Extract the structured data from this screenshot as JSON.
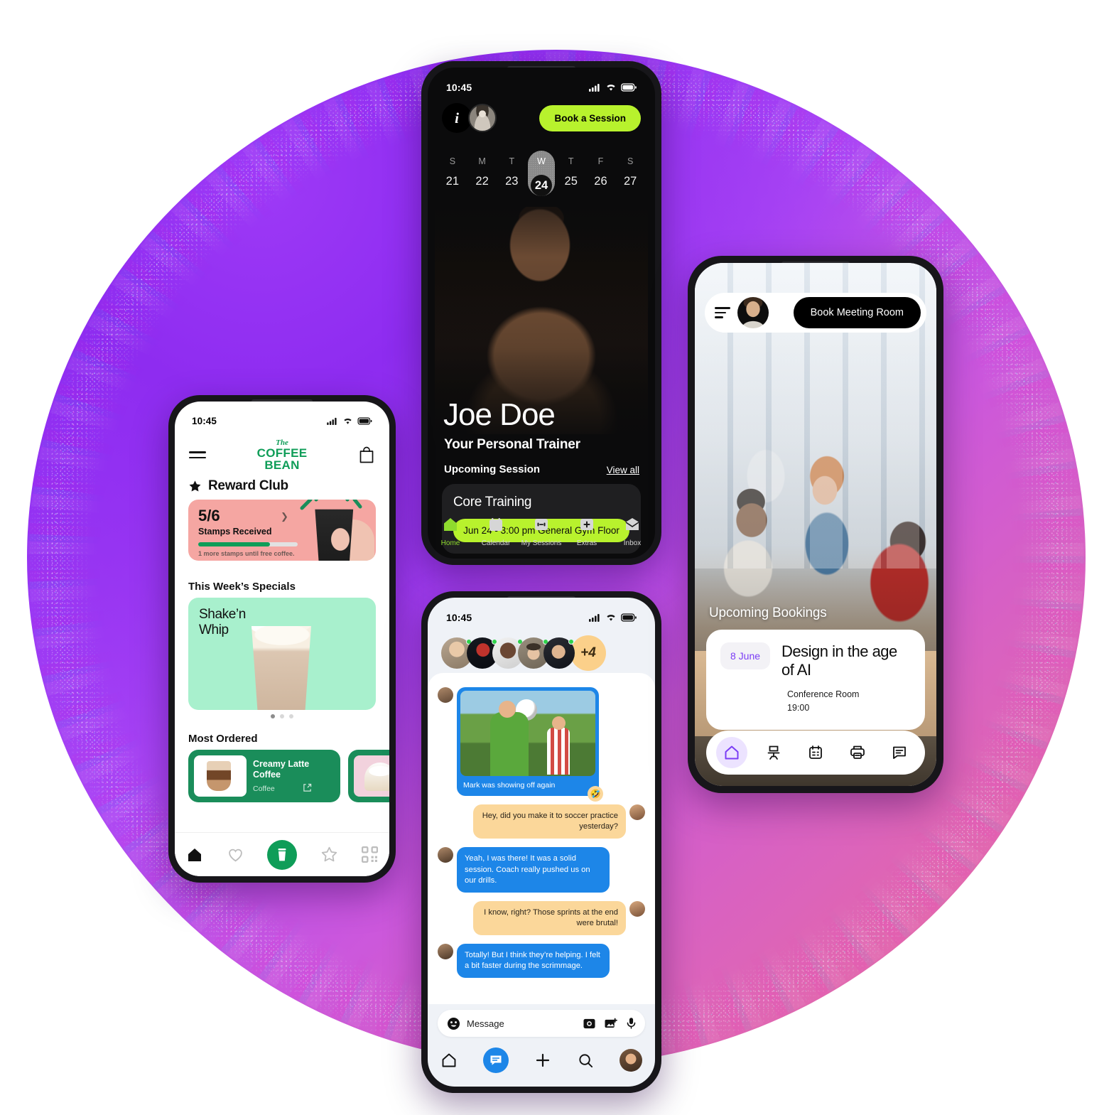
{
  "background": {
    "blob_gradient_from": "#8b2ae8",
    "blob_gradient_to": "#e673a0"
  },
  "fitness_app": {
    "status": {
      "time": "10:45",
      "signal_icon": "cellular-signal-icon",
      "wifi_icon": "wifi-icon",
      "battery_icon": "battery-icon"
    },
    "info_label": "i",
    "avatar_name": "user-avatar",
    "book_button": "Book a Session",
    "calendar": [
      {
        "dow": "S",
        "date": "21",
        "selected": false
      },
      {
        "dow": "M",
        "date": "22",
        "selected": false
      },
      {
        "dow": "T",
        "date": "23",
        "selected": false
      },
      {
        "dow": "W",
        "date": "24",
        "selected": true
      },
      {
        "dow": "T",
        "date": "25",
        "selected": false
      },
      {
        "dow": "F",
        "date": "26",
        "selected": false
      },
      {
        "dow": "S",
        "date": "27",
        "selected": false
      }
    ],
    "trainer_name": "Joe Doe",
    "trainer_role": "Your Personal Trainer",
    "section_label": "Upcoming Session",
    "view_all": "View all",
    "session": {
      "title": "Core Training",
      "chip": "Jun 24  - 3:00 pm General Gym Floor"
    },
    "nav": [
      {
        "label": "Home",
        "icon": "home-icon",
        "active": true
      },
      {
        "label": "Calendar",
        "icon": "calendar-icon",
        "active": false
      },
      {
        "label": "My Sessions",
        "icon": "dumbbell-icon",
        "active": false
      },
      {
        "label": "Extras",
        "icon": "plus-icon",
        "active": false
      },
      {
        "label": "Inbox",
        "icon": "envelope-icon",
        "active": false
      }
    ],
    "accent_green": "#b8f22d"
  },
  "coffee_app": {
    "status": {
      "time": "10:45",
      "signal_icon": "cellular-signal-icon",
      "wifi_icon": "wifi-icon",
      "battery_icon": "battery-icon"
    },
    "menu_icon": "hamburger-menu-icon",
    "bag_icon": "shopping-bag-icon",
    "logo": {
      "the": "The",
      "line1": "COFFEE",
      "line2": "BEAN"
    },
    "reward": {
      "title": "Reward Club",
      "star_icon": "star-icon",
      "fraction": "5/6",
      "subtitle": "Stamps Received",
      "note": "1 more stamps until free coffee.",
      "progress_pct": 72,
      "chevron_icon": "chevron-right-icon",
      "card_color": "#f5a6a2"
    },
    "specials_heading": "This Week’s Specials",
    "special": {
      "title_line1": "Shake’n",
      "title_line2": "Whip",
      "card_color": "#a8f0cd"
    },
    "carousel_dots": 3,
    "carousel_active": 0,
    "most_ordered_heading": "Most Ordered",
    "products": [
      {
        "name": "Creamy Latte Coffee",
        "category": "Coffee",
        "external_icon": "external-link-icon"
      },
      {
        "name": "",
        "category": ""
      }
    ],
    "nav": [
      {
        "icon": "home-icon",
        "active": true
      },
      {
        "icon": "heart-icon",
        "active": false
      },
      {
        "icon": "cup-icon",
        "active": true
      },
      {
        "icon": "star-outline-icon",
        "active": false
      },
      {
        "icon": "qr-code-icon",
        "active": false
      }
    ],
    "brand_green": "#0f9d58"
  },
  "chat_app": {
    "status": {
      "time": "10:45",
      "signal_icon": "cellular-signal-icon",
      "wifi_icon": "wifi-icon",
      "battery_icon": "battery-icon"
    },
    "story_avatars": 5,
    "more_badge": "+4",
    "messages": [
      {
        "side": "left",
        "type": "photo",
        "caption": "Mark was showing off again",
        "reaction": "🤣"
      },
      {
        "side": "right",
        "type": "text",
        "text": "Hey, did you make it to soccer practice yesterday?"
      },
      {
        "side": "left",
        "type": "text",
        "text": "Yeah, I was there! It was a solid session. Coach really pushed us on our drills."
      },
      {
        "side": "right",
        "type": "text",
        "text": "I know, right? Those sprints at the end were brutal!"
      },
      {
        "side": "left",
        "type": "text",
        "text": "Totally! But I think they’re helping. I felt a bit faster during the scrimmage."
      }
    ],
    "composer": {
      "emoji_icon": "emoji-smiley-icon",
      "placeholder": "Message",
      "camera_icon": "camera-icon",
      "gallery_icon": "gallery-add-icon",
      "mic_icon": "microphone-icon"
    },
    "nav": [
      {
        "icon": "home-icon",
        "active": false
      },
      {
        "icon": "chat-bubble-icon",
        "active": true
      },
      {
        "icon": "plus-icon",
        "active": false
      },
      {
        "icon": "search-icon",
        "active": false
      },
      {
        "icon": "profile-avatar",
        "active": false
      }
    ],
    "bubble_blue": "#1d86e8",
    "bubble_amber": "#fbd79a"
  },
  "office_app": {
    "menu_icon": "hamburger-menu-icon",
    "avatar_name": "user-avatar",
    "book_button": "Book  Meeting Room",
    "section_heading": "Upcoming Bookings",
    "booking": {
      "date": "8 June",
      "title": "Design in the age of AI",
      "room": "Conference Room",
      "time": "19:00",
      "date_color": "#7b3df5"
    },
    "nav": [
      {
        "icon": "home-icon",
        "active": true
      },
      {
        "icon": "office-chair-icon",
        "active": false
      },
      {
        "icon": "calendar-icon",
        "active": false
      },
      {
        "icon": "printer-icon",
        "active": false
      },
      {
        "icon": "chat-bubble-icon",
        "active": false
      }
    ]
  }
}
